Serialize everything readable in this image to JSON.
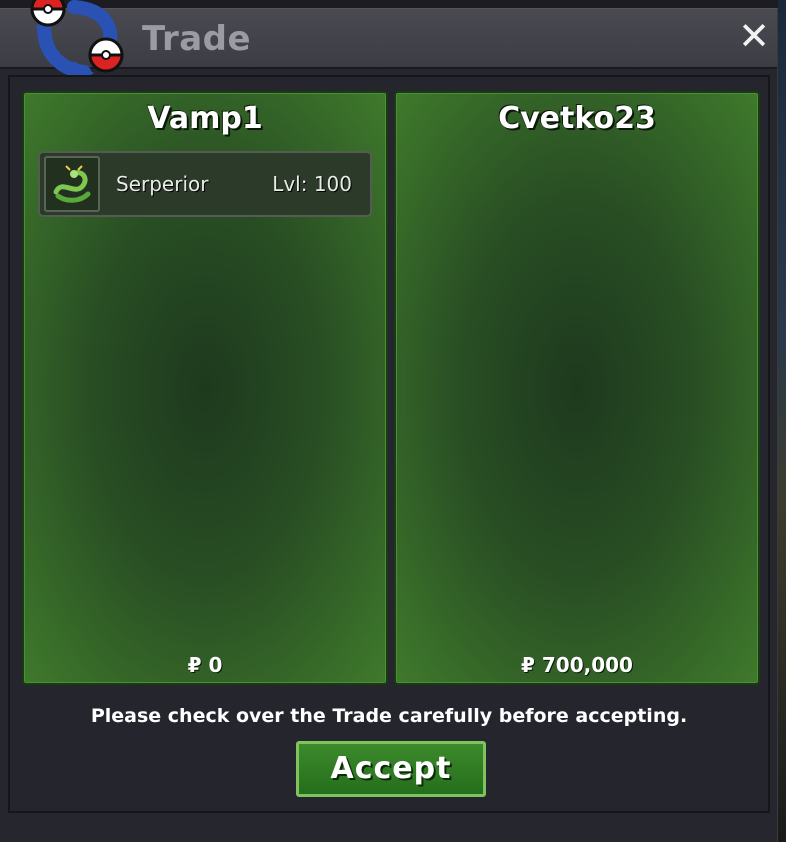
{
  "window": {
    "title": "Trade",
    "close_label": "✕"
  },
  "trade": {
    "left": {
      "player": "Vamp1",
      "pokemon": [
        {
          "icon": "serperior-icon",
          "name": "Serperior",
          "level": "Lvl: 100"
        }
      ],
      "money": "₽ 0"
    },
    "right": {
      "player": "Cvetko23",
      "pokemon": [],
      "money": "₽ 700,000"
    }
  },
  "notice": "Please check over the Trade carefully before accepting.",
  "accept_label": "Accept",
  "colors": {
    "panel_green": "#2f5a26",
    "button_green": "#2f7f24",
    "title_text": "#9b9ba3"
  }
}
